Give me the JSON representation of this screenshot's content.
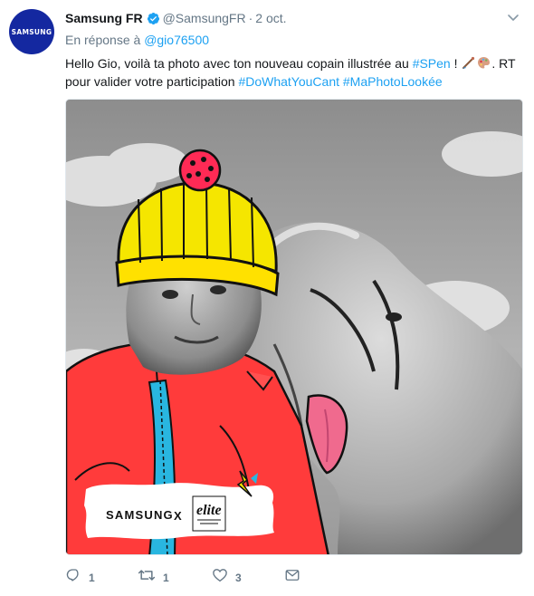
{
  "author": {
    "avatar_text": "SAMSUNG",
    "display_name": "Samsung FR",
    "handle": "@SamsungFR",
    "separator": "·",
    "time": "2 oct."
  },
  "reply": {
    "prefix": "En réponse à",
    "mention": "@gio76500"
  },
  "text": {
    "part1": "Hello Gio, voilà ta photo avec ton nouveau copain illustrée au ",
    "hashtag1": "#SPen",
    "part2": " ! ",
    "part3": ". RT pour valider votre participation ",
    "hashtag2": "#DoWhatYouCant",
    "part4": " ",
    "hashtag3": "#MaPhotoLookée"
  },
  "media": {
    "samsung_word": "SAMSUNG",
    "times": "X",
    "elite_word": "elite"
  },
  "actions": {
    "reply_count": "1",
    "retweet_count": "1",
    "like_count": "3"
  },
  "icons": {
    "verified": "verified-badge-icon",
    "caret": "chevron-down-icon",
    "reply": "reply-icon",
    "retweet": "retweet-icon",
    "like": "heart-icon",
    "message": "envelope-icon"
  },
  "colors": {
    "link": "#1da1f2",
    "secondary_text": "#657786",
    "samsung_blue": "#1428a0"
  }
}
